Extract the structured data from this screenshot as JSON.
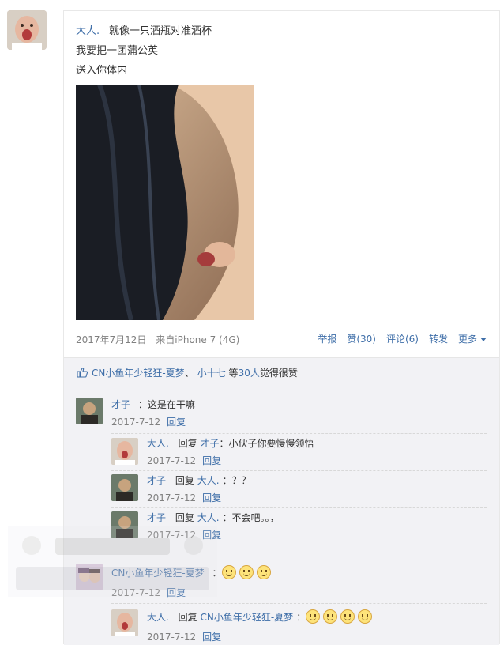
{
  "post": {
    "author": "大人.",
    "lines": [
      "就像一只酒瓶对准酒杯",
      "我要把一团蒲公英",
      "送入你体内"
    ],
    "date": "2017年7月12日",
    "source": "来自iPhone 7 (4G)"
  },
  "actions": {
    "report": "举报",
    "like": "赞(30)",
    "comment": "评论(6)",
    "forward": "转发",
    "more": "更多"
  },
  "likes": {
    "user1": "CN小鱼年少轻狂-夏梦",
    "sep": "、",
    "user2": "小十七",
    "mid": "等",
    "count": "30人",
    "tail": "觉得很赞"
  },
  "comments": [
    {
      "name": "才子",
      "text": "：这是在干嘛",
      "date": "2017-7-12",
      "reply": "回复"
    },
    {
      "name": "大人.",
      "reply_word": "回复",
      "target": "才子",
      "text": "：小伙子你要慢慢领悟",
      "date": "2017-7-12",
      "reply": "回复"
    },
    {
      "name": "才子",
      "reply_word": "回复",
      "target": "大人.",
      "text": "：？？",
      "date": "2017-7-12",
      "reply": "回复"
    },
    {
      "name": "才子",
      "reply_word": "回复",
      "target": "大人.",
      "text": "：不会吧。。，",
      "date": "2017-7-12",
      "reply": "回复"
    },
    {
      "name": "CN小鱼年少轻狂-夏梦",
      "text": "：",
      "emoji_count": 3,
      "date": "2017-7-12",
      "reply": "回复"
    },
    {
      "name": "大人.",
      "reply_word": "回复",
      "target": "CN小鱼年少轻狂-夏梦",
      "text": "：",
      "emoji_count": 4,
      "date": "2017-7-12",
      "reply": "回复"
    }
  ],
  "icons": [
    "thumbs-up-icon",
    "chevron-down-icon",
    "smile-emoji-icon"
  ],
  "colors": {
    "link": "#3e6ea8",
    "text": "#333333",
    "meta": "#808080",
    "comment_bg": "#f2f2f5"
  }
}
